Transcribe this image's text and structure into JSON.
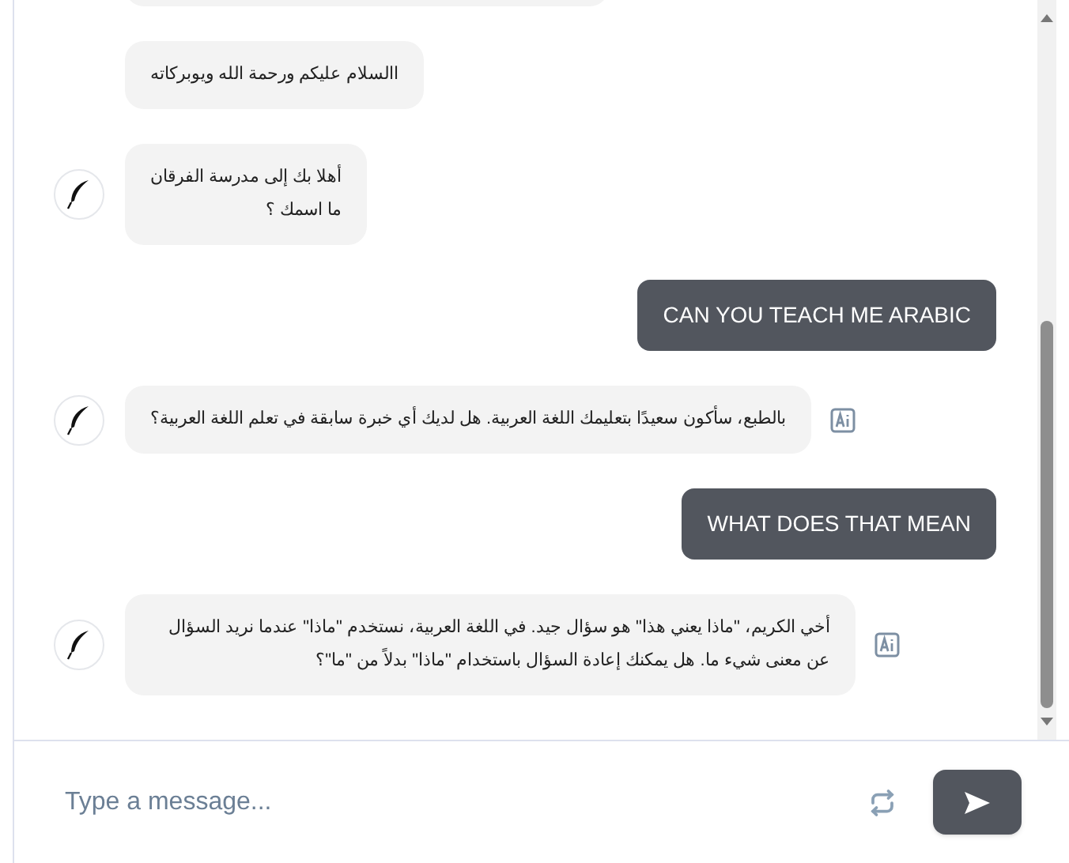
{
  "messages": [
    {
      "kind": "bot",
      "avatar": false,
      "ai_badge": false
    },
    {
      "kind": "bot",
      "avatar": false,
      "ai_badge": false,
      "text": "االسلام عليكم ورحمة الله ويوبركاته"
    },
    {
      "kind": "bot",
      "avatar": true,
      "ai_badge": false,
      "text": "أهلا بك إلى مدرسة الفرقان\nما اسمك ؟"
    },
    {
      "kind": "user",
      "text": "CAN YOU TEACH ME ARABIC"
    },
    {
      "kind": "bot",
      "avatar": true,
      "ai_badge": true,
      "text": "بالطبع، سأكون سعيدًا بتعليمك اللغة العربية. هل لديك أي خبرة سابقة في تعلم اللغة العربية؟"
    },
    {
      "kind": "user",
      "text": "WHAT DOES THAT MEAN"
    },
    {
      "kind": "bot",
      "avatar": true,
      "ai_badge": true,
      "text": "أخي الكريم، \"ماذا يعني هذا\" هو سؤال جيد. في اللغة العربية، نستخدم \"ماذا\" عندما نريد السؤال عن معنى شيء ما. هل يمكنك إعادة السؤال باستخدام \"ماذا\" بدلاً من \"ما\"؟"
    }
  ],
  "composer": {
    "placeholder": "Type a message..."
  }
}
